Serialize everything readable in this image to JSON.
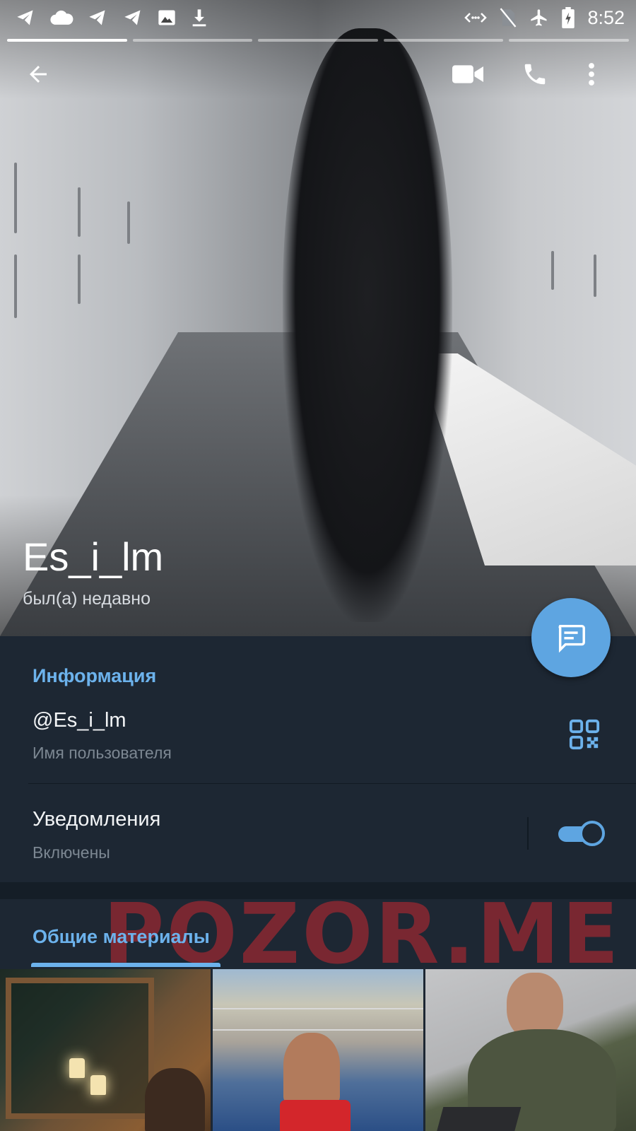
{
  "status_bar": {
    "time": "8:52",
    "left_icons": [
      "telegram-icon",
      "cloud-icon",
      "telegram-icon",
      "telegram-icon",
      "image-icon",
      "download-icon"
    ],
    "right_icons": [
      "data-saver-icon",
      "no-sim-icon",
      "airplane-mode-icon",
      "battery-charging-icon"
    ]
  },
  "story_progress": {
    "segments": 5,
    "active": 1
  },
  "action_bar": {
    "back_icon": "arrow-back-icon",
    "video_call_icon": "video-call-icon",
    "call_icon": "phone-icon",
    "menu_icon": "more-vert-icon"
  },
  "profile": {
    "name": "Es_i_lm",
    "status": "был(а) недавно"
  },
  "fab": {
    "icon": "message-icon"
  },
  "info": {
    "title": "Информация",
    "username_value": "@Es_i_lm",
    "username_label": "Имя пользователя",
    "qr_icon": "qr-code-icon",
    "notifications_label": "Уведомления",
    "notifications_status": "Включены",
    "notifications_enabled": true
  },
  "shared_media": {
    "title": "Общие материалы",
    "thumbnails": [
      "sauna-photo",
      "beach-pool-photo",
      "portrait-photo"
    ]
  },
  "watermark": "POZOR.ME",
  "colors": {
    "accent": "#6cb2ec",
    "fab": "#5ea5e1",
    "background": "#1d2733",
    "secondary_text": "#7c8792",
    "watermark": "#c42830"
  }
}
